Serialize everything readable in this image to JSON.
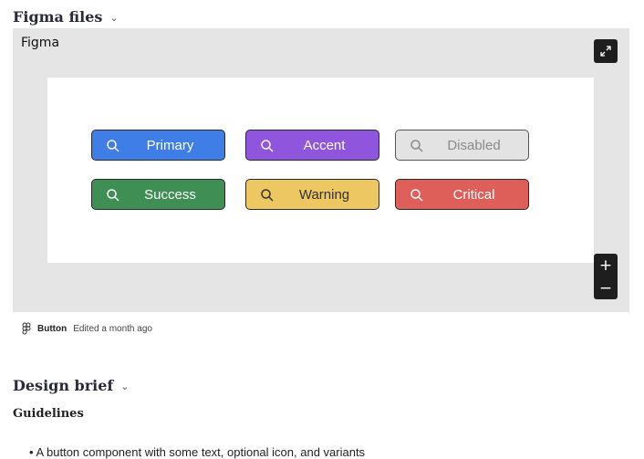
{
  "figma_section": {
    "title": "Figma files"
  },
  "embed": {
    "label": "Figma",
    "buttons": [
      {
        "label": "Primary",
        "bg": "#3f7ee6",
        "fg": "#ffffff",
        "icon_color": "#ffffff"
      },
      {
        "label": "Accent",
        "bg": "#8f55dc",
        "fg": "#ffffff",
        "icon_color": "#ffffff"
      },
      {
        "label": "Disabled",
        "bg": "#e3e3e3",
        "fg": "#8a8a8a",
        "icon_color": "#8a8a8a"
      },
      {
        "label": "Success",
        "bg": "#3f8f55",
        "fg": "#ffffff",
        "icon_color": "#ffffff"
      },
      {
        "label": "Warning",
        "bg": "#edc762",
        "fg": "#333333",
        "icon_color": "#333333"
      },
      {
        "label": "Critical",
        "bg": "#de5e5a",
        "fg": "#ffffff",
        "icon_color": "#ffffff"
      }
    ],
    "zoom_in": "+",
    "zoom_out": "−"
  },
  "file_meta": {
    "name": "Button",
    "edited": "Edited a month ago"
  },
  "design_brief": {
    "title": "Design brief",
    "guidelines_heading": "Guidelines",
    "bullet_1": "A button component with some text, optional icon, and variants"
  }
}
